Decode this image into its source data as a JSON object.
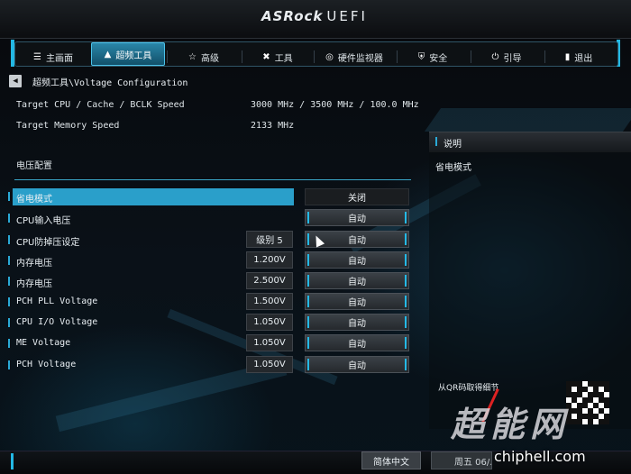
{
  "header": {
    "brand": "ASRock",
    "product": "UEFI"
  },
  "nav": {
    "tabs": [
      {
        "label": "主画面",
        "icon": "list-icon",
        "active": false
      },
      {
        "label": "超频工具",
        "icon": "rocket-icon",
        "active": true
      },
      {
        "label": "高级",
        "icon": "star-icon",
        "active": false
      },
      {
        "label": "工具",
        "icon": "tools-icon",
        "active": false
      },
      {
        "label": "硬件监视器",
        "icon": "monitor-icon",
        "active": false
      },
      {
        "label": "安全",
        "icon": "shield-icon",
        "active": false
      },
      {
        "label": "引导",
        "icon": "power-icon",
        "active": false
      },
      {
        "label": "退出",
        "icon": "exit-door-icon",
        "active": false
      }
    ]
  },
  "breadcrumb": "超频工具\\Voltage Configuration",
  "info": [
    {
      "label": "Target CPU / Cache / BCLK Speed",
      "value": "3000 MHz / 3500 MHz / 100.0 MHz"
    },
    {
      "label": "Target Memory Speed",
      "value": "2133 MHz"
    }
  ],
  "section_title": "电压配置",
  "rows": [
    {
      "label": "省电模式",
      "value": "",
      "option": "关闭",
      "selected": true
    },
    {
      "label": "CPU输入电压",
      "value": "",
      "option": "自动"
    },
    {
      "label": "CPU防掉压设定",
      "value": "级别 5",
      "option": "自动"
    },
    {
      "label": "内存电压",
      "value": "1.200V",
      "option": "自动"
    },
    {
      "label": "内存电压",
      "value": "2.500V",
      "option": "自动"
    },
    {
      "label": "PCH PLL Voltage",
      "value": "1.500V",
      "option": "自动"
    },
    {
      "label": "CPU I/O Voltage",
      "value": "1.050V",
      "option": "自动"
    },
    {
      "label": "ME Voltage",
      "value": "1.050V",
      "option": "自动"
    },
    {
      "label": "PCH Voltage",
      "value": "1.050V",
      "option": "自动"
    }
  ],
  "help": {
    "title": "说明",
    "body": "省电模式",
    "qr_caption": "从QR码取得细节"
  },
  "watermark": {
    "text": "超能网",
    "site": "chiphell.com"
  },
  "footer": {
    "language": "简体中文",
    "datetime": "周五 06/..."
  },
  "colors": {
    "accent": "#23b8e4",
    "highlight": "#2a9fca"
  }
}
